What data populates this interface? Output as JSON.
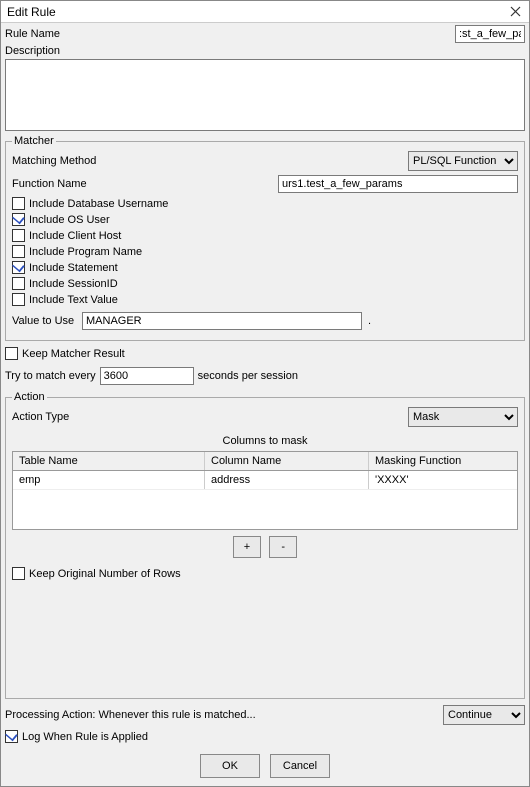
{
  "window": {
    "title": "Edit Rule"
  },
  "ruleName": {
    "label": "Rule Name",
    "value": ":st_a_few_params"
  },
  "description": {
    "label": "Description",
    "value": ""
  },
  "matcher": {
    "legend": "Matcher",
    "matchingMethod": {
      "label": "Matching Method",
      "value": "PL/SQL Function"
    },
    "functionName": {
      "label": "Function Name",
      "value": "urs1.test_a_few_params"
    },
    "includes": [
      {
        "label": "Include Database Username",
        "checked": false
      },
      {
        "label": "Include OS User",
        "checked": true
      },
      {
        "label": "Include Client Host",
        "checked": false
      },
      {
        "label": "Include Program Name",
        "checked": false
      },
      {
        "label": "Include Statement",
        "checked": true
      },
      {
        "label": "Include SessionID",
        "checked": false
      },
      {
        "label": "Include Text Value",
        "checked": false
      }
    ],
    "valueToUse": {
      "label": "Value to Use",
      "value": "MANAGER",
      "trailing": "."
    }
  },
  "keepMatcherResult": {
    "label": "Keep Matcher Result",
    "checked": false
  },
  "tryMatch": {
    "label": "Try to match every",
    "value": "3600",
    "suffix": "seconds per session"
  },
  "action": {
    "legend": "Action",
    "actionType": {
      "label": "Action Type",
      "value": "Mask"
    },
    "columnsHeader": "Columns to mask",
    "columns": [
      "Table Name",
      "Column Name",
      "Masking Function"
    ],
    "rows": [
      {
        "table": "emp",
        "column": "address",
        "mask": "'XXXX'"
      }
    ],
    "addBtn": "+",
    "removeBtn": "-",
    "keepRows": {
      "label": "Keep Original Number of Rows",
      "checked": false
    }
  },
  "processing": {
    "label": "Processing Action: Whenever this rule is matched...",
    "value": "Continue"
  },
  "logWhenApplied": {
    "label": "Log When Rule is Applied",
    "checked": true
  },
  "buttons": {
    "ok": "OK",
    "cancel": "Cancel"
  }
}
